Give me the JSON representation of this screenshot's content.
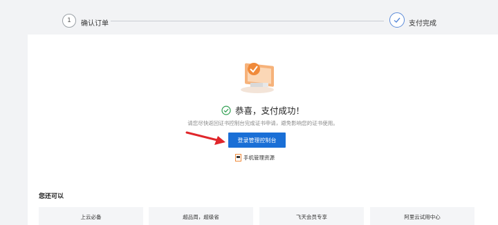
{
  "steps": {
    "step1_number": "1",
    "step1_label": "确认订单",
    "step2_label": "支付完成"
  },
  "result": {
    "title": "恭喜，支付成功！",
    "hint": "请您尽快返回证书控制台完成证书申请，避免影响您的证书使用。",
    "login_button": "登录管理控制台",
    "mobile_label": "手机管理资源"
  },
  "more": {
    "title": "您还可以",
    "tiles": [
      "上云必备",
      "超品周，超级省",
      "飞天会员专享",
      "阿里云试用中心"
    ]
  },
  "colors": {
    "primary": "#1a6fd6",
    "success": "#2e9e4f",
    "arrow": "#e0262b",
    "illustration_orange": "#f08a3a"
  }
}
